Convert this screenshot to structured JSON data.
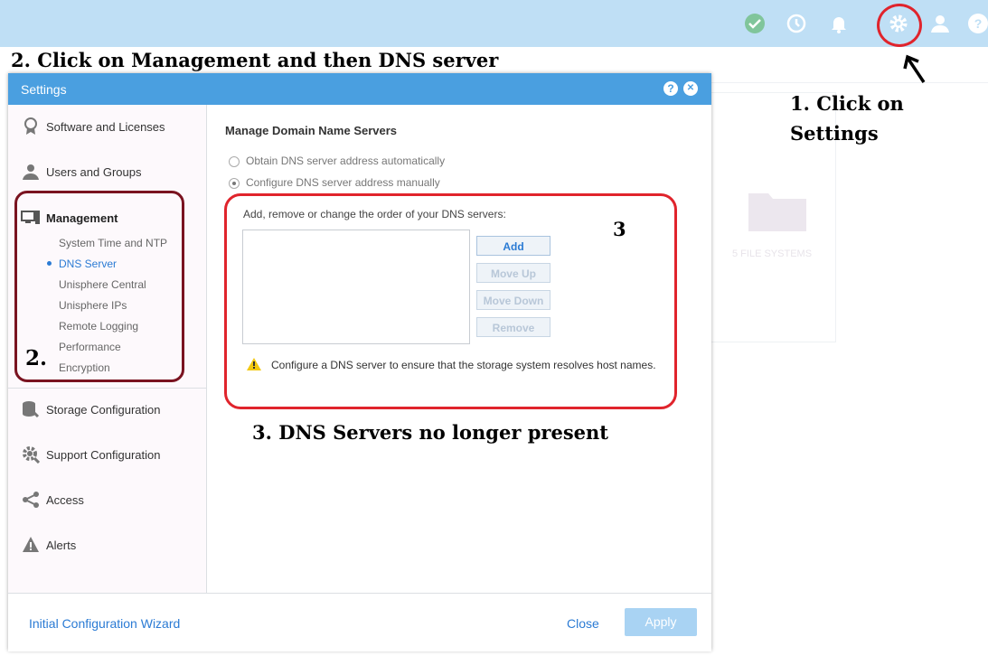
{
  "topbar": {
    "icons": [
      "check-status-icon",
      "history-icon",
      "bell-icon",
      "gear-icon",
      "user-icon",
      "help-icon"
    ],
    "colors": {
      "background": "#bfdff5",
      "check": "#4caf50"
    }
  },
  "background": {
    "card_label": "5 FILE SYSTEMS"
  },
  "annotations": {
    "step2_header": "2. Click on Management and then DNS server",
    "step1_line1": "1. Click on",
    "step1_line2": "Settings",
    "step2_marker": "2.",
    "step3_marker": "3",
    "step3_caption": "3. DNS Servers no longer present",
    "colors": {
      "red": "#e0242c",
      "maroon": "#7a1320"
    }
  },
  "dialog": {
    "title": "Settings",
    "help_label": "?",
    "close_label": "✕",
    "header_color": "#4a9fe0"
  },
  "sidebar": {
    "software": "Software and Licenses",
    "users": "Users and Groups",
    "management": "Management",
    "management_subitems": [
      "System Time and NTP",
      "DNS Server",
      "Unisphere Central",
      "Unisphere IPs",
      "Remote Logging",
      "Performance",
      "Encryption"
    ],
    "active_subitem": "DNS Server",
    "storage": "Storage Configuration",
    "support": "Support Configuration",
    "access": "Access",
    "alerts": "Alerts"
  },
  "content": {
    "title": "Manage Domain Name Servers",
    "radio_auto": "Obtain DNS server address automatically",
    "radio_manual": "Configure DNS server address manually",
    "selected_radio": "manual",
    "instructions": "Add, remove or change the order of your DNS servers:",
    "dns_servers": [],
    "buttons": {
      "add": "Add",
      "move_up": "Move Up",
      "move_down": "Move Down",
      "remove": "Remove"
    },
    "warning": "Configure a DNS server to ensure that the storage system resolves host names."
  },
  "footer": {
    "wizard": "Initial Configuration Wizard",
    "close": "Close",
    "apply": "Apply"
  }
}
